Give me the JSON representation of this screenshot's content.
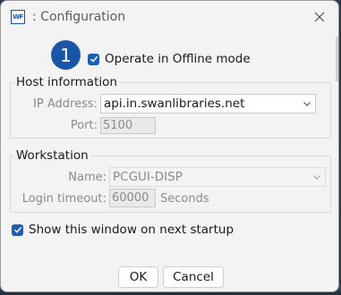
{
  "window": {
    "app_icon_text": "WF",
    "title": ": Configuration"
  },
  "offline": {
    "step_number": "1",
    "label": "Operate in Offline mode",
    "checked": true
  },
  "host": {
    "group_title": "Host information",
    "ip_label": "IP Address:",
    "ip_value": "api.in.swanlibraries.net",
    "port_label": "Port:",
    "port_value": "5100"
  },
  "workstation": {
    "group_title": "Workstation",
    "name_label": "Name:",
    "name_value": "PCGUI-DISP",
    "timeout_label": "Login timeout:",
    "timeout_value": "60000",
    "timeout_unit": "Seconds"
  },
  "startup": {
    "label": "Show this window on next startup",
    "checked": true
  },
  "buttons": {
    "ok": "OK",
    "cancel": "Cancel"
  },
  "colors": {
    "accent": "#1a5fb4",
    "badge": "#1a56a8"
  }
}
